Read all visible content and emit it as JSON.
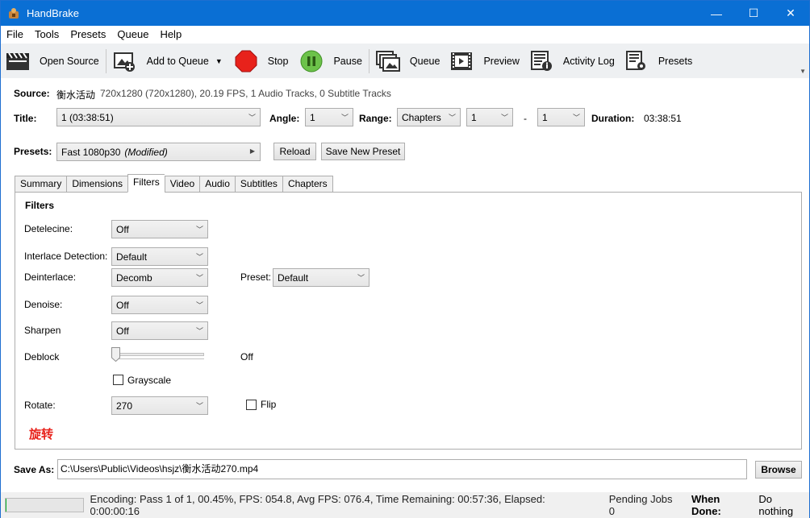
{
  "window": {
    "title": "HandBrake",
    "minimize": "—",
    "maximize": "☐",
    "close": "✕"
  },
  "menu": [
    "File",
    "Tools",
    "Presets",
    "Queue",
    "Help"
  ],
  "toolbar": {
    "open_source": "Open Source",
    "add_to_queue": "Add to Queue",
    "stop": "Stop",
    "pause": "Pause",
    "queue": "Queue",
    "preview": "Preview",
    "activity_log": "Activity Log",
    "presets": "Presets"
  },
  "source": {
    "label": "Source:",
    "name": "衡水活动",
    "info": "720x1280 (720x1280), 20.19 FPS, 1 Audio Tracks, 0 Subtitle Tracks"
  },
  "title_row": {
    "title_label": "Title:",
    "title_value": "1 (03:38:51)",
    "angle_label": "Angle:",
    "angle_value": "1",
    "range_label": "Range:",
    "range_type": "Chapters",
    "range_start": "1",
    "range_dash": "-",
    "range_end": "1",
    "duration_label": "Duration:",
    "duration_value": "03:38:51"
  },
  "presets_row": {
    "label": "Presets:",
    "value": "Fast 1080p30",
    "modified": "(Modified)",
    "reload": "Reload",
    "save_new": "Save New Preset"
  },
  "tabs": [
    "Summary",
    "Dimensions",
    "Filters",
    "Video",
    "Audio",
    "Subtitles",
    "Chapters"
  ],
  "active_tab": "Filters",
  "filters": {
    "heading": "Filters",
    "detelecine_label": "Detelecine:",
    "detelecine_value": "Off",
    "interlace_label": "Interlace Detection:",
    "interlace_value": "Default",
    "deinterlace_label": "Deinterlace:",
    "deinterlace_value": "Decomb",
    "preset_label": "Preset:",
    "preset_value": "Default",
    "denoise_label": "Denoise:",
    "denoise_value": "Off",
    "sharpen_label": "Sharpen",
    "sharpen_value": "Off",
    "deblock_label": "Deblock",
    "deblock_value": "Off",
    "deblock_level": 0,
    "grayscale_label": "Grayscale",
    "grayscale_checked": false,
    "rotate_label": "Rotate:",
    "rotate_value": "270",
    "flip_label": "Flip",
    "flip_checked": false,
    "annotation": "旋转",
    "annotation_color": "#e8221b"
  },
  "save_as": {
    "label": "Save As:",
    "path": "C:\\Users\\Public\\Videos\\hsjz\\衡水活动270.mp4",
    "browse": "Browse"
  },
  "status": {
    "encoding": "Encoding: Pass 1 of 1,  00.45%, FPS: 054.8,  Avg FPS: 076.4,  Time Remaining: 00:57:36,  Elapsed: 0:00:00:16",
    "progress": 0.0045,
    "pending": "Pending Jobs 0",
    "when_done_label": "When Done:",
    "when_done_value": "Do nothing"
  }
}
